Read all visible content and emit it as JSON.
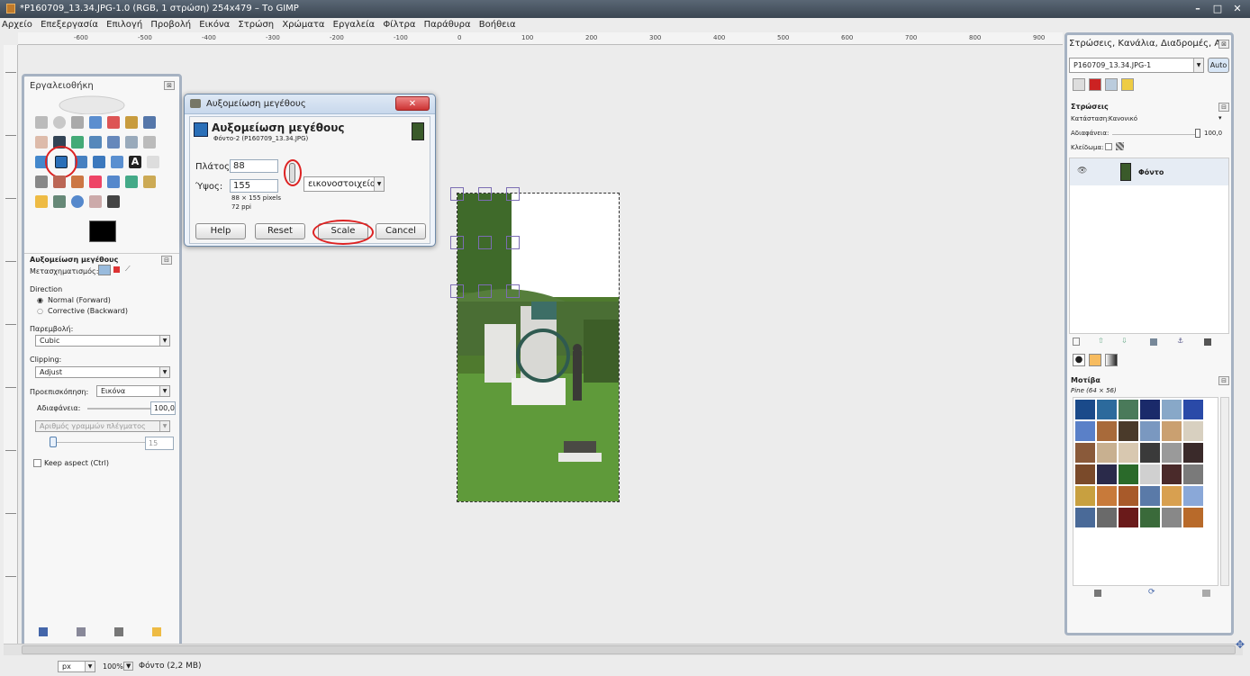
{
  "window": {
    "title": "*P160709_13.34.JPG-1.0 (RGB, 1 στρώση) 254x479 – Το GIMP",
    "controls": [
      "–",
      "□",
      "✕"
    ]
  },
  "menu": [
    "Αρχείο",
    "Επεξεργασία",
    "Επιλογή",
    "Προβολή",
    "Εικόνα",
    "Στρώση",
    "Χρώματα",
    "Εργαλεία",
    "Φίλτρα",
    "Παράθυρα",
    "Βοήθεια"
  ],
  "ruler": {
    "labels": [
      "-600",
      "-500",
      "-400",
      "-300",
      "-200",
      "-100",
      "0",
      "100",
      "200",
      "300",
      "400",
      "500",
      "600",
      "700",
      "800",
      "900"
    ]
  },
  "toolbox": {
    "title": "Εργαλειοθήκη",
    "tool_options_title": "Αυξομείωση μεγέθους",
    "transform_label": "Μετασχηματισμός:",
    "direction_label": "Direction",
    "direction_normal": "Normal (Forward)",
    "direction_corrective": "Corrective (Backward)",
    "interpolation_label": "Παρεμβολή:",
    "interpolation_value": "Cubic",
    "clipping_label": "Clipping:",
    "clipping_value": "Adjust",
    "preview_label": "Προεπισκόπηση:",
    "preview_value": "Εικόνα",
    "opacity_label": "Αδιαφάνεια:",
    "opacity_value": "100,0",
    "grid_lines_label": "Αριθμός γραμμών πλέγματος",
    "grid_lines_value": "15",
    "keep_aspect": "Keep aspect  (Ctrl)"
  },
  "scale_dialog": {
    "title": "Αυξομείωση μεγέθους",
    "heading": "Αυξομείωση μεγέθους",
    "subheading": "Φόντο-2 (P160709_13.34.JPG)",
    "width_label": "Πλάτος:",
    "width_value": "88",
    "height_label": "Ύψος:",
    "height_value": "155",
    "unit": "εικονοστοιχεία",
    "info_size": "88 × 155 pixels",
    "info_res": "72 ppi",
    "help": "Help",
    "reset": "Reset",
    "scale": "Scale",
    "cancel": "Cancel",
    "close": "✕"
  },
  "layers_panel": {
    "title": "Στρώσεις, Κανάλια, Διαδρομές, Α...",
    "image_select": "P160709_13.34.JPG-1",
    "auto": "Auto",
    "layers_header": "Στρώσεις",
    "mode_label": "Κατάσταση:",
    "mode_value": "Κανονικό",
    "opacity_label": "Αδιαφάνεια:",
    "opacity_value": "100,0",
    "lock_label": "Κλείδωμα:",
    "layer_name": "Φόντο"
  },
  "patterns_panel": {
    "header": "Μοτίβα",
    "selected": "Pine (64 × 56)"
  },
  "status": {
    "unit": "px",
    "zoom": "100%",
    "info": "Φόντο (2,2 MB)"
  },
  "colors": {
    "titlebar": "#3f4a57",
    "highlight": "#d22222",
    "selection": "#7c6db3"
  }
}
